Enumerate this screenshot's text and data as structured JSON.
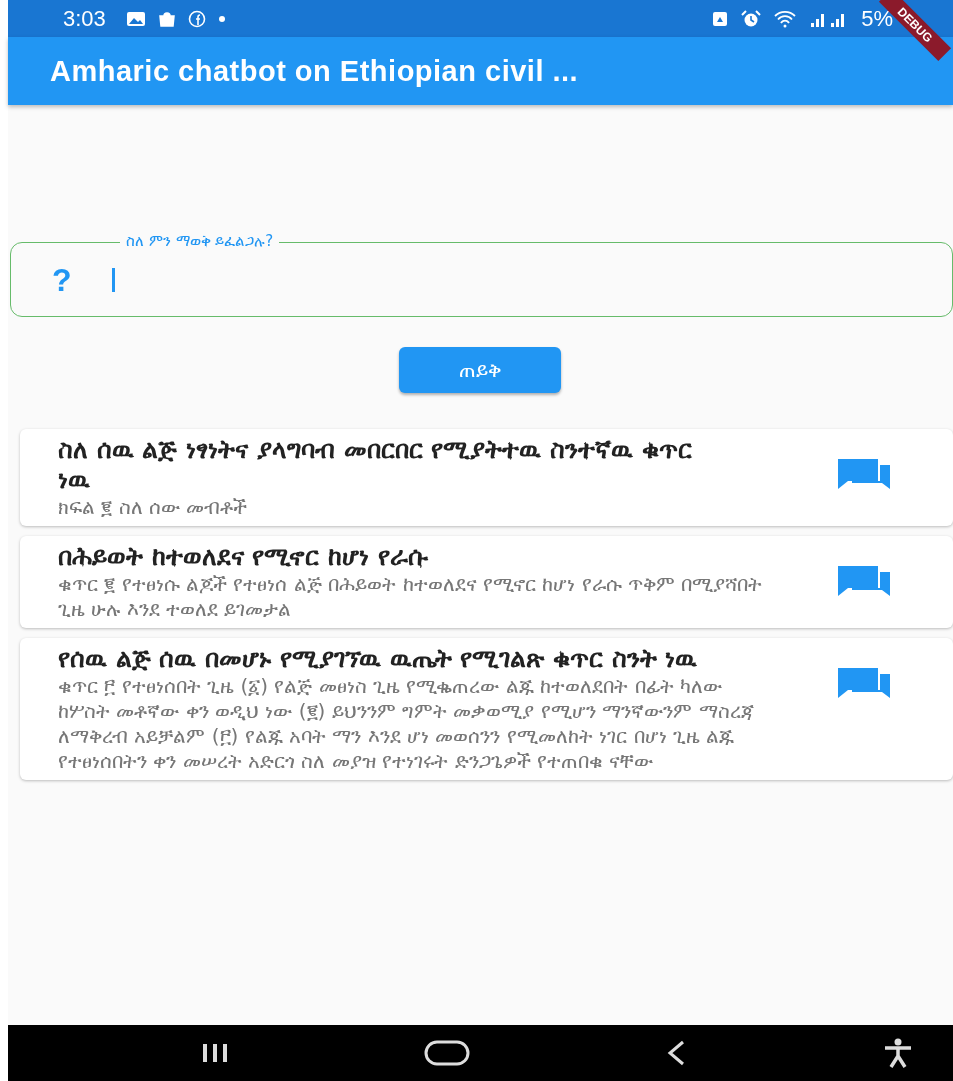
{
  "status_bar": {
    "time": "3:03",
    "battery": "5%"
  },
  "debug_banner": "DEBUG",
  "app_bar": {
    "title": "Amharic chatbot on Ethiopian civil ..."
  },
  "question_field": {
    "label": "ስለ ምን ማወቅ ይፈልጋሉ?",
    "prefix": "?",
    "focused": true
  },
  "ask_button": "ጠይቅ",
  "results": [
    {
      "title": "ስለ ሰዉ ልጅ ነፃነትና ያላግባብ መበርበር የሚያትተዉ ስንተኛዉ ቁጥር ነዉ",
      "subtitle": "ክፍል ፪ ስለ ሰው መብቶች"
    },
    {
      "title": "በሕይወት ከተወለደና የሚኖር ከሆነ የራሱ",
      "subtitle": "ቁጥር ፪ የተፀነሱ ልጆች የተፀነሰ ልጅ በሕይወት ከተወለደና የሚኖር ከሆነ የራሱ ጥቅም በሚያሻበት ጊዜ ሁሉ እንደ ተወለደ ይገመታል"
    },
    {
      "title": "የሰዉ ልጅ ሰዉ በመሆኑ የሚያገኘዉ ዉጤት የሚገልጽ ቁጥር ስንት ነዉ",
      "subtitle": "ቁጥር ፫ የተፀነሰበት ጊዜ (፩) የልጅ መፀነስ ጊዜ የሚቈጠረው ልጁ ከተወለደበት በፊት ካለው ከሦስት መቶኛው ቀን ወዲህ ነው (፪) ይህንንም ግምት መቃወሚያ የሚሆን ማንኛውንም ማስረጃ ለማቅረብ አይቻልም (፫) የልጁ አባት ማን እንደ ሆነ መወሰንን የሚመለከት ነገር በሆነ ጊዜ ልጁ የተፀነሰበትን ቀን መሠረት አድርጎ ስለ መያዝ የተነገሩት ድንጋጌዎች የተጠበቁ ናቸው"
    }
  ]
}
